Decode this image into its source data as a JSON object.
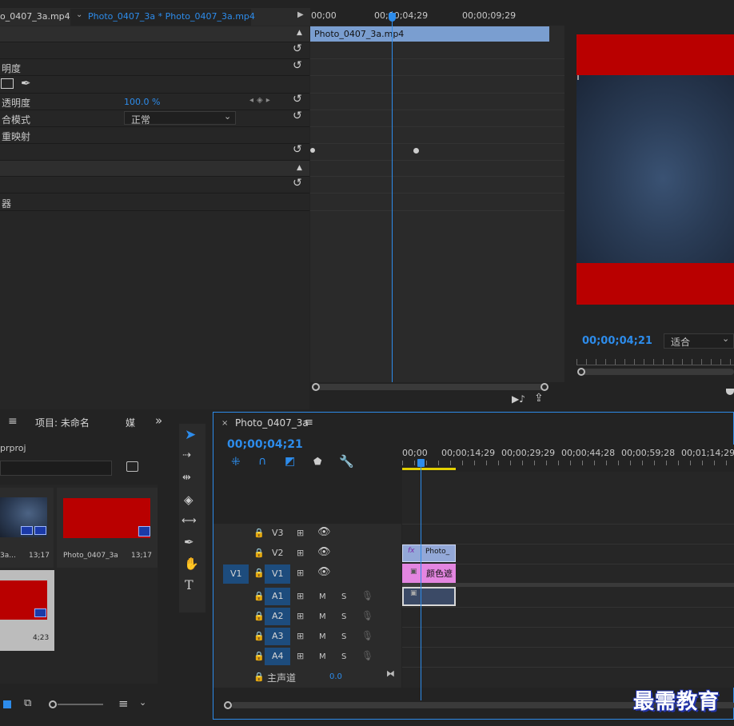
{
  "effect_controls": {
    "source_tab": "o_0407_3a.mp4",
    "sequence_tab": "Photo_0407_3a * Photo_0407_3a.mp4",
    "rows": {
      "opacity_header": "明度",
      "opacity": "透明度",
      "opacity_value": "100.0 %",
      "blend_mode": "合模式",
      "blend_value": "正常",
      "time_remap": "重映射",
      "row_tail": "器"
    },
    "timeline": {
      "ruler": [
        "00;00",
        "00;00;04;29",
        "00;00;09;29"
      ],
      "clip": "Photo_0407_3a.mp4"
    }
  },
  "program": {
    "timecode": "00;00;04;21",
    "fit": "适合",
    "colors": {
      "red": "#b90000",
      "sky": "#23324a"
    }
  },
  "project": {
    "tab_label": "项目: 未命名",
    "media_tab": "媒",
    "file": "prproj",
    "items": [
      {
        "name": "3a...",
        "duration": "13;17"
      },
      {
        "name": "Photo_0407_3a",
        "duration": "13;17"
      },
      {
        "name": "",
        "duration": "4;23"
      }
    ]
  },
  "sequence": {
    "tab": "Photo_0407_3a",
    "timecode": "00;00;04;21",
    "ruler": [
      "00;00",
      "00;00;14;29",
      "00;00;29;29",
      "00;00;44;28",
      "00;00;59;28",
      "00;01;14;29"
    ],
    "tracks": {
      "video": [
        "V3",
        "V2",
        "V1"
      ],
      "source_patch": "V1",
      "audio": [
        "A1",
        "A2",
        "A3",
        "A4"
      ],
      "mute": "M",
      "solo": "S",
      "master": "主声道",
      "master_value": "0.0"
    },
    "clips": {
      "v2": "Photo_",
      "v1": "颜色遮",
      "fx_badge": "fx"
    }
  },
  "watermark": "最需教育"
}
